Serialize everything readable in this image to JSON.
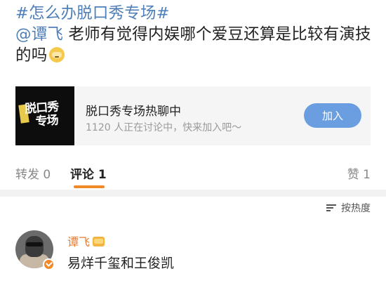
{
  "post": {
    "topic": "#怎么办脱口秀专场#",
    "mention": "@谭飞",
    "text": " 老师有觉得内娱哪个爱豆还算是比较有演技的吗",
    "emoji_icon": "doge-emoji-icon"
  },
  "group_card": {
    "thumb_text_line1": "脱口秀",
    "thumb_text_line2": "专场",
    "title": "脱口秀专场热聊中",
    "subtitle": "1120 人正在讨论中，快来加入吧～",
    "join_label": "加入",
    "accent_color": "#6a9ee0"
  },
  "tabs": {
    "repost": "转发 0",
    "comment": "评论 1",
    "like": "赞 1",
    "active_color": "#f08a28"
  },
  "sort": {
    "label": "按热度",
    "icon": "sort-icon"
  },
  "comment": {
    "author": "谭飞",
    "author_color": "#e8792d",
    "text": "易烊千玺和王俊凯",
    "verified_icon": "verified-badge-icon",
    "crown_icon": "vip-crown-icon"
  }
}
